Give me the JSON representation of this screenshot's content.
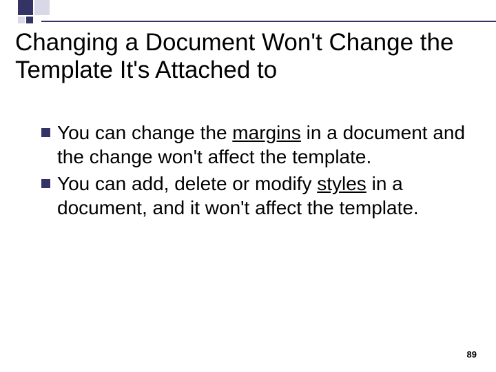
{
  "title": "Changing a Document Won't Change the Template It's Attached to",
  "bullets": [
    {
      "pre": "You can change the ",
      "u": "margins",
      "post": " in a document and the change won't affect the template."
    },
    {
      "pre": "You can add, delete or modify ",
      "u": "styles",
      "post": " in a document, and it won't affect the template."
    }
  ],
  "page_number": "89"
}
